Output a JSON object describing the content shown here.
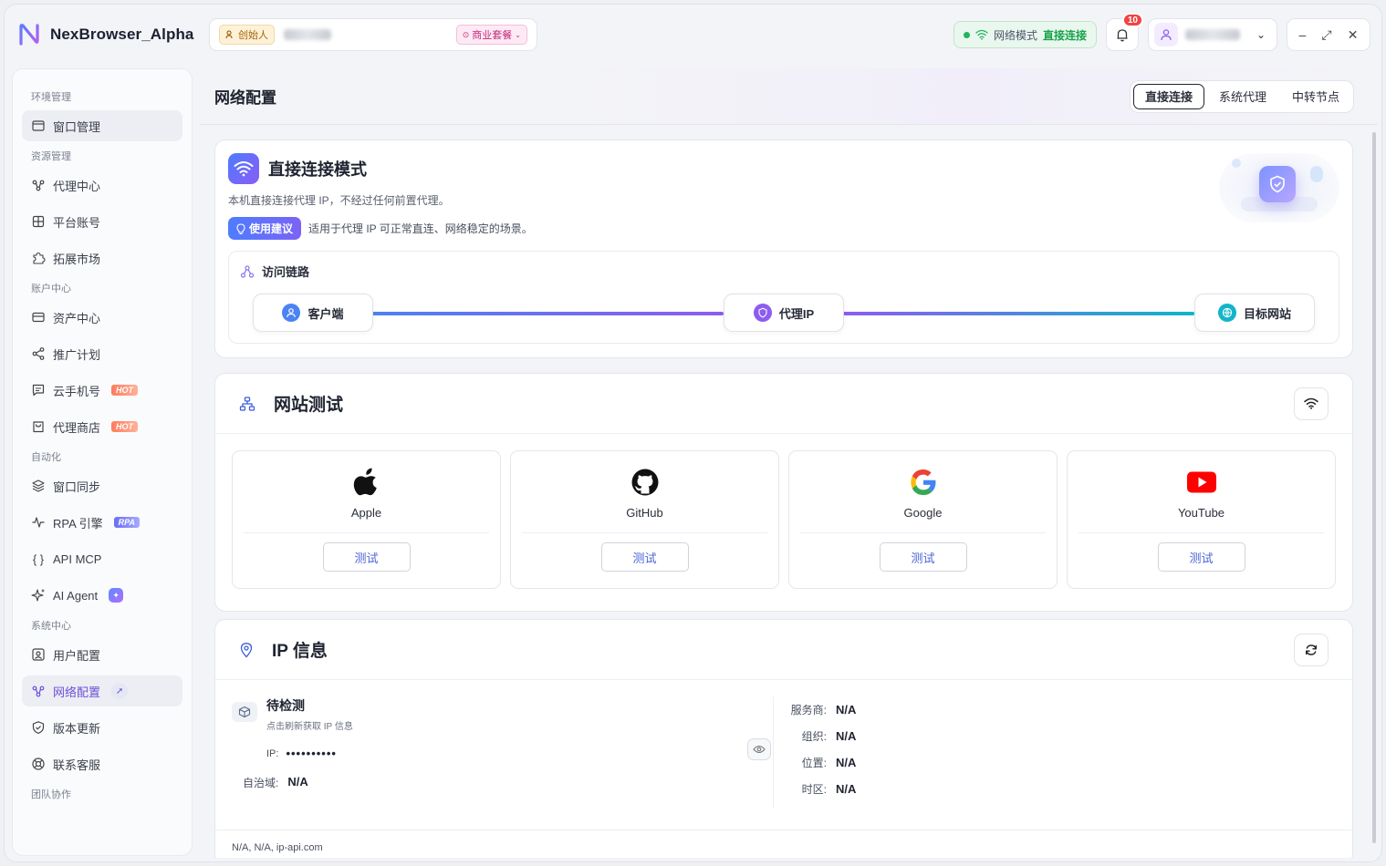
{
  "app": {
    "name": "NexBrowser_Alpha"
  },
  "workspace": {
    "role": "创始人",
    "plan": "商业套餐"
  },
  "topbar": {
    "network_mode_label": "网络模式",
    "network_mode_value": "直接连接",
    "notifications": "10"
  },
  "sidebar": {
    "sections": [
      {
        "title": "环境管理",
        "items": [
          {
            "label": "窗口管理",
            "icon": "window-icon"
          }
        ]
      },
      {
        "title": "资源管理",
        "items": [
          {
            "label": "代理中心",
            "icon": "proxy-icon"
          },
          {
            "label": "平台账号",
            "icon": "grid-icon"
          },
          {
            "label": "拓展市场",
            "icon": "puzzle-icon"
          }
        ]
      },
      {
        "title": "账户中心",
        "items": [
          {
            "label": "资产中心",
            "icon": "wallet-icon"
          },
          {
            "label": "推广计划",
            "icon": "share-icon"
          },
          {
            "label": "云手机号",
            "icon": "message-icon",
            "badge": "HOT"
          },
          {
            "label": "代理商店",
            "icon": "shop-icon",
            "badge": "HOT"
          }
        ]
      },
      {
        "title": "自动化",
        "items": [
          {
            "label": "窗口同步",
            "icon": "layers-icon"
          },
          {
            "label": "RPA 引擎",
            "icon": "pulse-icon",
            "badge": "RPA"
          },
          {
            "label": "API MCP",
            "icon": "braces-icon"
          },
          {
            "label": "AI Agent",
            "icon": "sparkle-icon"
          }
        ]
      },
      {
        "title": "系统中心",
        "items": [
          {
            "label": "用户配置",
            "icon": "user-settings-icon"
          },
          {
            "label": "网络配置",
            "icon": "network-icon"
          },
          {
            "label": "版本更新",
            "icon": "shield-icon"
          },
          {
            "label": "联系客服",
            "icon": "lifebuoy-icon"
          }
        ]
      },
      {
        "title": "团队协作",
        "items": []
      }
    ]
  },
  "page": {
    "title": "网络配置",
    "tabs": [
      "直接连接",
      "系统代理",
      "中转节点"
    ],
    "active_tab": "直接连接"
  },
  "direct": {
    "title": "直接连接模式",
    "desc": "本机直接连接代理 IP，不经过任何前置代理。",
    "tip_label": "使用建议",
    "tip_text": "适用于代理 IP 可正常直连、网络稳定的场景。",
    "chain_title": "访问链路",
    "nodes": [
      "客户端",
      "代理IP",
      "目标网站"
    ]
  },
  "webtest": {
    "title": "网站测试",
    "sites": [
      {
        "name": "Apple",
        "button": "测试",
        "icon": "apple-icon"
      },
      {
        "name": "GitHub",
        "button": "测试",
        "icon": "github-icon"
      },
      {
        "name": "Google",
        "button": "测试",
        "icon": "google-icon"
      },
      {
        "name": "YouTube",
        "button": "测试",
        "icon": "youtube-icon"
      }
    ]
  },
  "ipinfo": {
    "title": "IP 信息",
    "status": "待检测",
    "hint": "点击刷新获取 IP 信息",
    "ip_label": "IP:",
    "ip_value": "••••••••••",
    "asn_label": "自治域:",
    "asn_value": "N/A",
    "details": [
      {
        "key": "服务商:",
        "value": "N/A"
      },
      {
        "key": "组织:",
        "value": "N/A"
      },
      {
        "key": "位置:",
        "value": "N/A"
      },
      {
        "key": "时区:",
        "value": "N/A"
      }
    ],
    "footer": "N/A, N/A, ip-api.com"
  },
  "colors": {
    "accent": "#6d4fd8",
    "success": "#16a34a",
    "danger": "#ef4444"
  }
}
